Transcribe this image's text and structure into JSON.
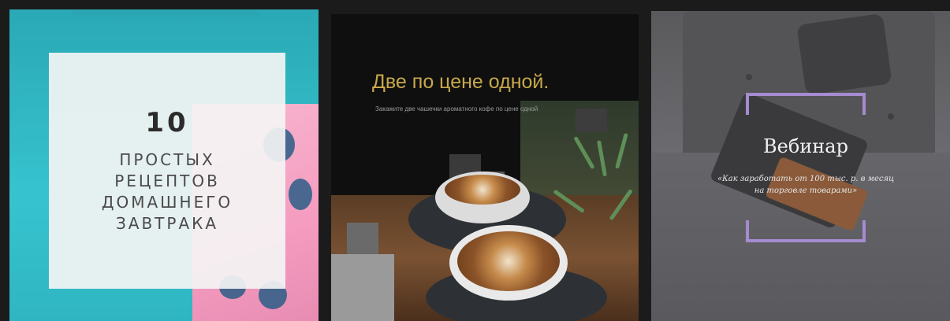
{
  "cards": [
    {
      "number": "10",
      "lines": [
        "ПРОСТЫХ",
        "РЕЦЕПТОВ",
        "ДОМАШНЕГО",
        "ЗАВТРАКА"
      ],
      "accent": "#36c3cf"
    },
    {
      "title": "Две по цене одной.",
      "subtitle": "Закажите две чашечки ароматного кофе по цене одной",
      "accent": "#c8a94a"
    },
    {
      "title": "Вебинар",
      "subtitle": "«Как заработать от 100 тыс. р. в месяц на торговле товарами»",
      "accent": "#a58bd0"
    }
  ]
}
